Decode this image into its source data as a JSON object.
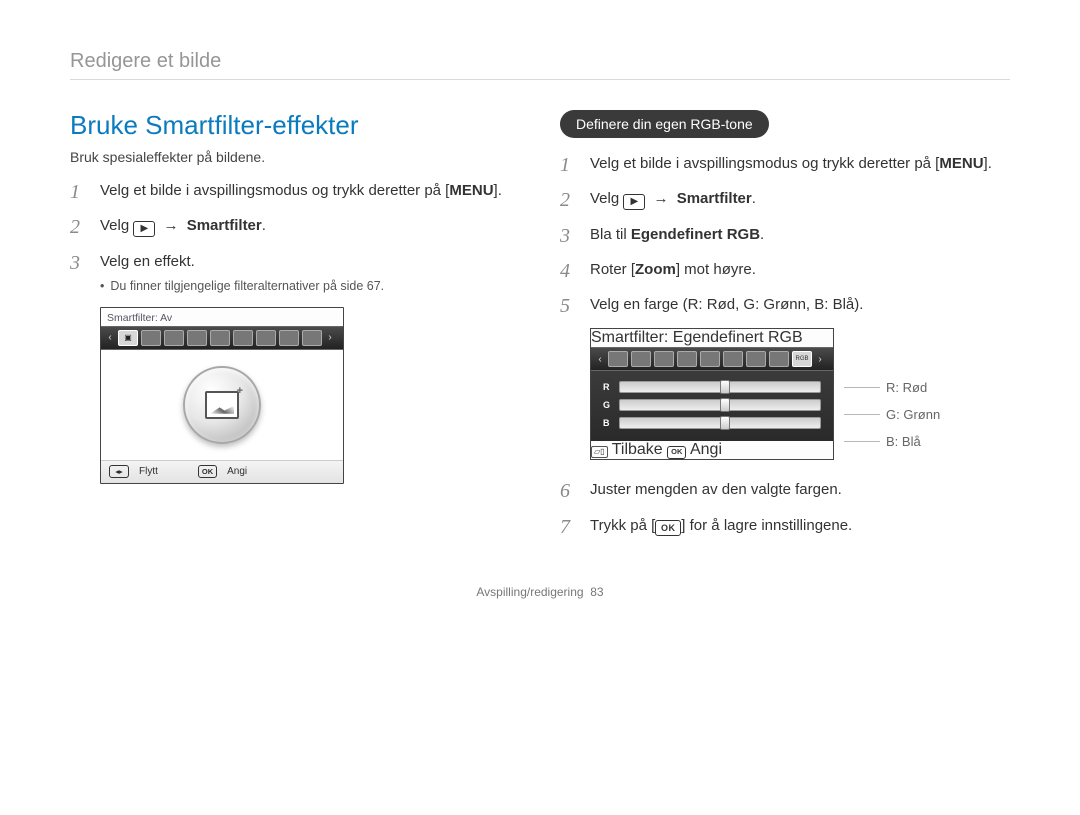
{
  "breadcrumb": "Redigere et bilde",
  "left": {
    "heading": "Bruke Smartfilter-effekter",
    "lead": "Bruk spesialeffekter på bildene.",
    "steps": [
      {
        "num": "1",
        "text_a": "Velg et bilde i avspillingsmodus og trykk deretter på [",
        "bold": "MENU",
        "text_b": "]."
      },
      {
        "num": "2",
        "text_a": "Velg ",
        "icon": "edit",
        "arrow": " → ",
        "bold": "Smartfilter",
        "text_b": "."
      },
      {
        "num": "3",
        "text_a": "Velg en effekt.",
        "bold": "",
        "text_b": ""
      }
    ],
    "note": "Du finner tilgjengelige filteralternativer på side 67.",
    "screen": {
      "title": "Smartfilter: Av",
      "bottom_move_label": "Flytt",
      "bottom_ok_label": "Angi",
      "ok_icon_text": "OK"
    }
  },
  "right": {
    "pill": "Definere din egen RGB-tone",
    "steps": [
      {
        "num": "1",
        "text_a": "Velg et bilde i avspillingsmodus og trykk deretter på [",
        "bold": "MENU",
        "text_b": "]."
      },
      {
        "num": "2",
        "text_a": "Velg ",
        "icon": "edit",
        "arrow": " → ",
        "bold": "Smartfilter",
        "text_b": "."
      },
      {
        "num": "3",
        "text_a": "Bla til ",
        "bold": "Egendefinert RGB",
        "text_b": "."
      },
      {
        "num": "4",
        "text_a": "Roter [",
        "bold": "Zoom",
        "text_b": "] mot høyre."
      },
      {
        "num": "5",
        "text_a": "Velg en farge (R: Rød, G: Grønn, B: Blå).",
        "bold": "",
        "text_b": ""
      }
    ],
    "screen": {
      "title": "Smartfilter: Egendefinert RGB",
      "sliders": [
        {
          "label": "R",
          "thumb_pct": 50
        },
        {
          "label": "G",
          "thumb_pct": 50
        },
        {
          "label": "B",
          "thumb_pct": 50
        }
      ],
      "bottom_back_label": "Tilbake",
      "bottom_ok_label": "Angi",
      "ok_icon_text": "OK"
    },
    "legend": {
      "r": "R: Rød",
      "g": "G: Grønn",
      "b": "B: Blå"
    },
    "steps_after": [
      {
        "num": "6",
        "text_a": "Juster mengden av den valgte fargen.",
        "bold": "",
        "text_b": ""
      },
      {
        "num": "7",
        "text_a": "Trykk på [",
        "icon": "ok",
        "text_b": "] for å lagre innstillingene."
      }
    ]
  },
  "footer": {
    "section": "Avspilling/redigering",
    "page": "83"
  },
  "icons": {
    "ok_text": "OK",
    "edit_glyph": "▶"
  }
}
